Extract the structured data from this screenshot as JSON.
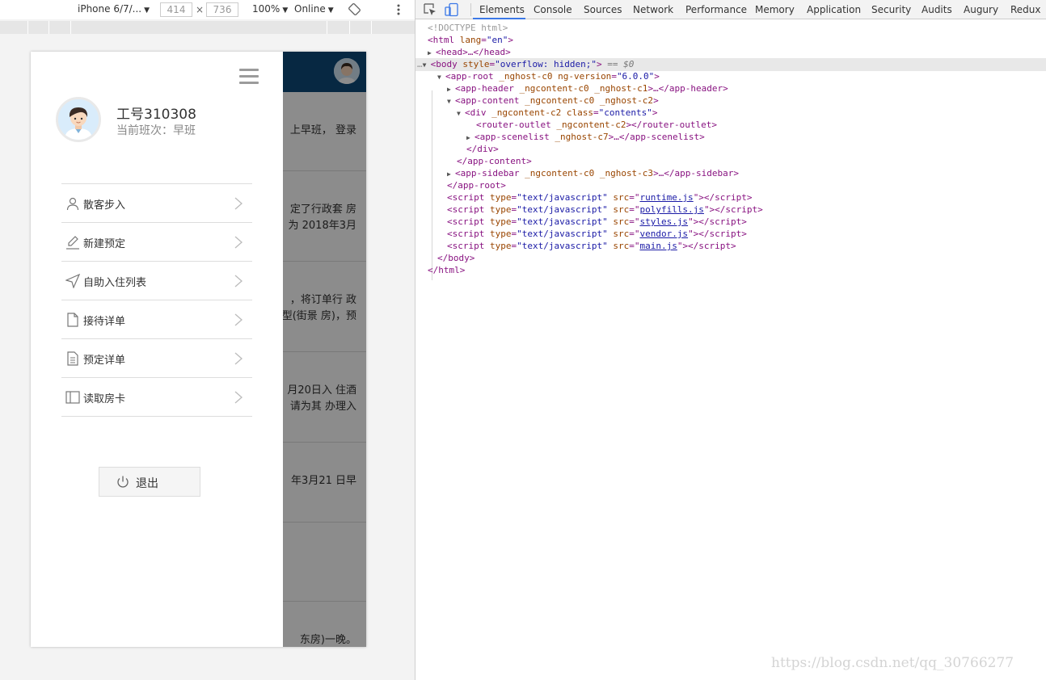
{
  "device_toolbar": {
    "device": "iPhone 6/7/...",
    "width": "414",
    "height": "736",
    "times": "×",
    "zoom": "100%",
    "network": "Online"
  },
  "app": {
    "sidebar": {
      "employee_no": "工号310308",
      "shift": "当前班次：早班",
      "menu": [
        {
          "label": "散客步入",
          "icon": "user-icon"
        },
        {
          "label": "新建预定",
          "icon": "pencil-icon"
        },
        {
          "label": "自助入住列表",
          "icon": "navigation-arrow-icon"
        },
        {
          "label": "接待详单",
          "icon": "document-icon"
        },
        {
          "label": "预定详单",
          "icon": "document-lines-icon"
        },
        {
          "label": "读取房卡",
          "icon": "card-icon"
        }
      ],
      "logout": "退出"
    },
    "scene_list": [
      {
        "lines": [
          "上早班， 登录"
        ]
      },
      {
        "lines": [
          "定了行政套 房",
          "为 2018年3月"
        ]
      },
      {
        "lines": [
          "，将订单行 政",
          "型(街景 房)，预"
        ]
      },
      {
        "lines": [
          "月20日入 住酒",
          "请为其 办理入"
        ]
      },
      {
        "lines": [
          "年3月21 日早"
        ]
      },
      {
        "lines": []
      },
      {
        "lines": [
          "东房)一晚。"
        ]
      }
    ]
  },
  "devtools": {
    "tabs": [
      "Elements",
      "Console",
      "Sources",
      "Network",
      "Performance",
      "Memory",
      "Application",
      "Security",
      "Audits",
      "Augury",
      "Redux"
    ],
    "active_tab": "Elements",
    "tree": {
      "doctype": "<!DOCTYPE html>",
      "html_open": "<html",
      "lang_attr": "lang",
      "lang_val": "\"en\"",
      "head": "<head>…</head>",
      "body_tag": "<body",
      "body_attr": "style",
      "body_val": "\"overflow: hidden;\"",
      "body_eq": "== $0",
      "approot_tag": "<app-root",
      "approot_attrs": "_nghost-c0 ng-version",
      "approot_ver": "\"6.0.0\"",
      "appheader": "<app-header",
      "appheader_attrs": "_ngcontent-c0 _nghost-c1",
      "appheader_end": ">…</app-header>",
      "appcontent": "<app-content",
      "appcontent_attrs": "_ngcontent-c0 _nghost-c2",
      "div_tag": "<div",
      "div_attrs": "_ngcontent-c2 class",
      "div_class": "\"contents\"",
      "router_tag": "<router-outlet",
      "router_attrs": "_ngcontent-c2",
      "router_end": "></router-outlet>",
      "scenelist": "<app-scenelist",
      "scenelist_attrs": "_nghost-c7",
      "scenelist_end": ">…</app-scenelist>",
      "div_close": "</div>",
      "appcontent_close": "</app-content>",
      "appsidebar": "<app-sidebar",
      "appsidebar_attrs": "_ngcontent-c0 _nghost-c3",
      "appsidebar_end": ">…</app-sidebar>",
      "approot_close": "</app-root>",
      "script_type": "type",
      "script_type_val": "\"text/javascript\"",
      "script_src": "src",
      "scripts": [
        "runtime.js",
        "polyfills.js",
        "styles.js",
        "vendor.js",
        "main.js"
      ],
      "body_close": "</body>",
      "html_close": "</html>"
    }
  },
  "watermark": "https://blog.csdn.net/qq_30766277",
  "colors": {
    "app_header": "#0e4a78",
    "devtools_accent": "#3b78e7",
    "tag": "#881280",
    "attr_name": "#994500",
    "attr_value": "#1a1aa6"
  }
}
